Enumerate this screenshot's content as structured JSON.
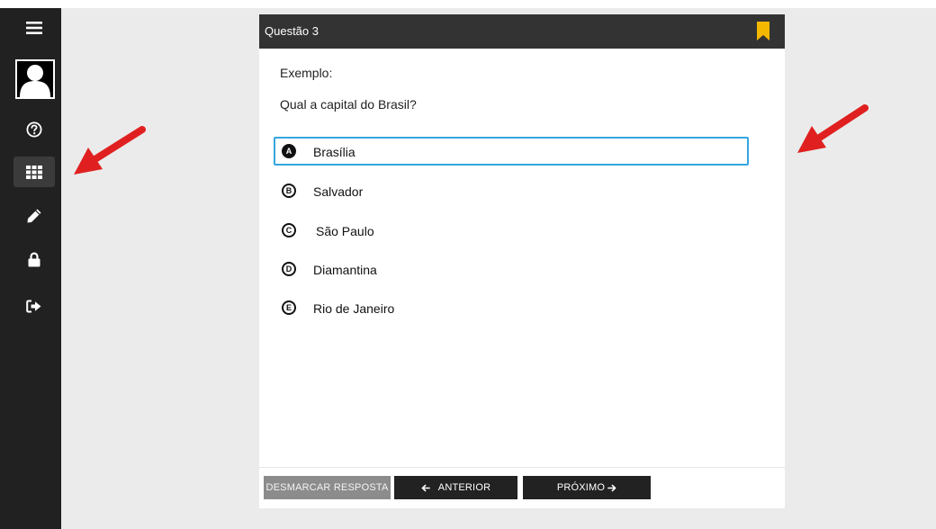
{
  "sidebar": {
    "items": [
      {
        "icon": "menu-icon"
      },
      {
        "icon": "avatar"
      },
      {
        "icon": "help-icon"
      },
      {
        "icon": "grid-icon",
        "active": true
      },
      {
        "icon": "pencil-icon"
      },
      {
        "icon": "lock-icon"
      },
      {
        "icon": "logout-icon"
      }
    ]
  },
  "question": {
    "header_title": "Questão 3",
    "bookmark_color": "#f5b800",
    "example_label": "Exemplo:",
    "text": "Qual a capital do Brasil?",
    "options": [
      {
        "letter": "A",
        "label": "Brasília",
        "selected": true
      },
      {
        "letter": "B",
        "label": "Salvador",
        "selected": false
      },
      {
        "letter": "C",
        "label": "São Paulo",
        "selected": false
      },
      {
        "letter": "D",
        "label": "Diamantina",
        "selected": false
      },
      {
        "letter": "E",
        "label": "Rio de Janeiro",
        "selected": false
      }
    ]
  },
  "footer": {
    "clear_label": "DESMARCAR RESPOSTA",
    "prev_label": "ANTERIOR",
    "next_label": "PRÓXIMO"
  },
  "colors": {
    "sidebar": "#212121",
    "header": "#333333",
    "selected_border": "#35a6e0",
    "annotation_arrow": "#e02020"
  }
}
